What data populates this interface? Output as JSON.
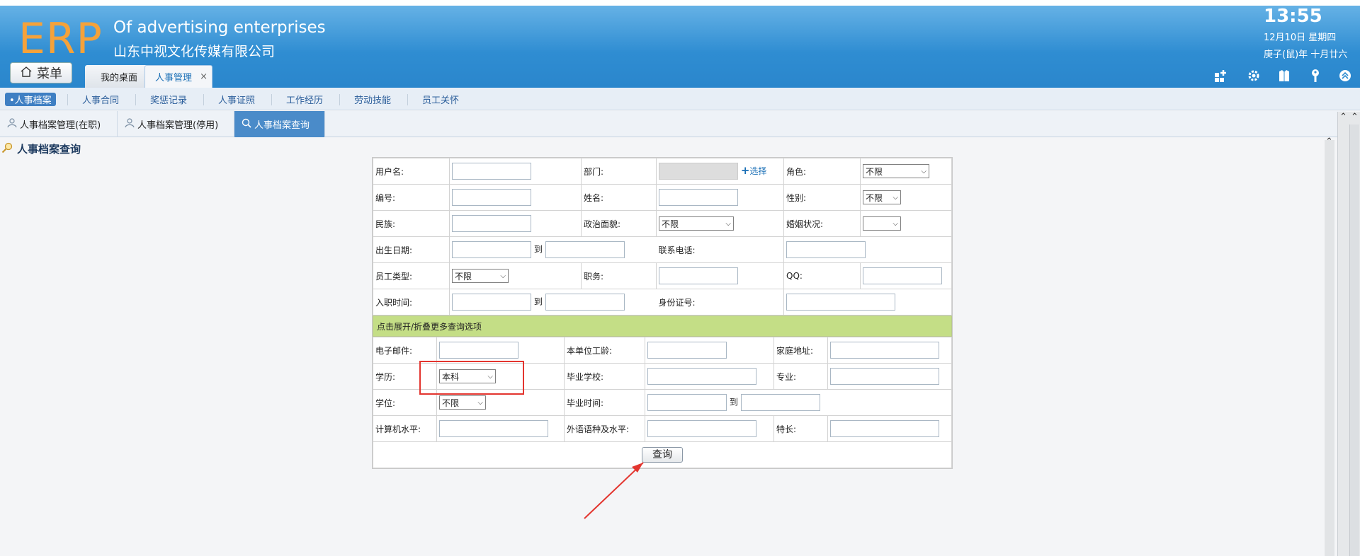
{
  "header": {
    "logo": "ERP",
    "subtitle_en": "Of advertising enterprises",
    "subtitle_cn": "山东中视文化传媒有限公司",
    "time": "13:55",
    "date": "12月10日 星期四",
    "lunar": "庚子(鼠)年 十月廿六",
    "menu_label": "菜单",
    "tabs": [
      {
        "label": "我的桌面"
      },
      {
        "label": "人事管理",
        "close": "×"
      }
    ],
    "icons": [
      "add-widget-icon",
      "settings-icon",
      "shirt-icon",
      "key-icon",
      "collapse-icon"
    ]
  },
  "subnav": {
    "items": [
      "•人事档案",
      "人事合同",
      "奖惩记录",
      "人事证照",
      "工作经历",
      "劳动技能",
      "员工关怀"
    ]
  },
  "page_tabs": [
    "人事档案管理(在职)",
    "人事档案管理(停用)",
    "人事档案查询"
  ],
  "page_title": "人事档案查询",
  "form": {
    "labels": {
      "username": "用户名:",
      "dept": "部门:",
      "role": "角色:",
      "number": "编号:",
      "name": "姓名:",
      "gender": "性别:",
      "ethnicity": "民族:",
      "political": "政治面貌:",
      "marital": "婚姻状况:",
      "birth": "出生日期:",
      "phone": "联系电话:",
      "emp_type": "员工类型:",
      "position": "职务:",
      "qq": "QQ:",
      "hire": "入职时间:",
      "idcard": "身份证号:",
      "email": "电子邮件:",
      "seniority": "本单位工龄:",
      "address": "家庭地址:",
      "education": "学历:",
      "school": "毕业学校:",
      "major": "专业:",
      "degree": "学位:",
      "grad_time": "毕业时间:",
      "computer": "计算机水平:",
      "language": "外语语种及水平:",
      "skill": "特长:"
    },
    "to": "到",
    "select_link": "选择",
    "role_value": "不限",
    "gender_value": "不限",
    "political_value": "不限",
    "marital_value": "",
    "emp_type_value": "不限",
    "education_value": "本科",
    "degree_value": "不限",
    "expand_band": "点击展开/折叠更多查询选项",
    "query_button": "查询"
  },
  "colors": {
    "highlight": "#e3352f",
    "band": "#c4de86",
    "header": "#2f8dd2"
  }
}
